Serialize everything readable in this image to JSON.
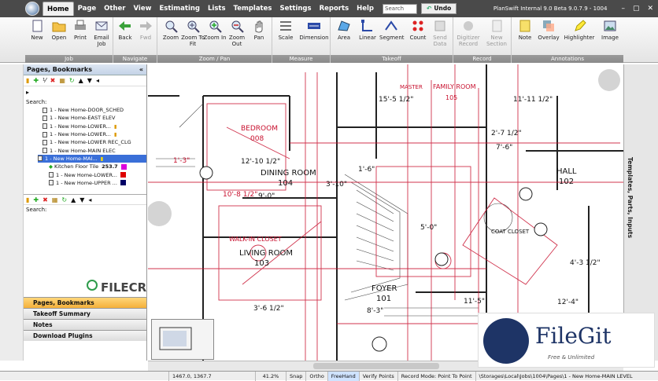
{
  "menubar": {
    "items": [
      "Home",
      "Page",
      "Other",
      "View",
      "Estimating",
      "Lists",
      "Templates",
      "Settings",
      "Reports",
      "Help"
    ],
    "search_value": "Search",
    "undo_label": "Undo",
    "window_title": "PlanSwift Internal 9.0 Beta  9.0.7.9 - 1004",
    "min": "–",
    "max": "▢",
    "close": "✕"
  },
  "ribbon": {
    "groups": [
      {
        "label": "Job",
        "buttons": [
          "New",
          "Open",
          "Print",
          "Email Job"
        ]
      },
      {
        "label": "Navigate",
        "buttons": [
          "Back",
          "Fwd"
        ]
      },
      {
        "label": "Zoom / Pan",
        "buttons": [
          "Zoom",
          "Zoom To Fit",
          "Zoom In",
          "Zoom Out",
          "Pan"
        ]
      },
      {
        "label": "Measure",
        "buttons": [
          "Scale",
          "Dimension"
        ]
      },
      {
        "label": "Takeoff",
        "buttons": [
          "Area",
          "Linear",
          "Segment",
          "Count",
          "Send Data"
        ]
      },
      {
        "label": "Record",
        "buttons": [
          "Digitizer Record",
          "New Section"
        ]
      },
      {
        "label": "Annotations",
        "buttons": [
          "Note",
          "Overlay",
          "Highlighter",
          "Image"
        ]
      }
    ]
  },
  "sidebar": {
    "header": "Pages, Bookmarks",
    "collapse": "«",
    "search_label": "Search:",
    "tree": [
      "1 - New Home-DOOR_SCHED",
      "1 - New Home-EAST ELEV",
      "1 - New Home-LOWER...",
      "1 - New Home-LOWER...",
      "1 - New Home-LOWER REC_CLG",
      "1 - New Home-MAIN ELEC",
      "1 - New Home-MAI...",
      "Kitchen Floor Tile",
      "1 - New Home-LOWER...",
      "1 - New Home-UPPER ..."
    ],
    "kitchen_value": "253.7",
    "search2_label": "Search:",
    "nav_tabs": [
      "Pages, Bookmarks",
      "Takeoff Summary",
      "Notes",
      "Download Plugins"
    ]
  },
  "right_panel": {
    "label": "Templates, Parts, Inputs"
  },
  "statusbar": {
    "coords": "1467.0, 1367.7",
    "zoom": "41.2%",
    "snap": "Snap",
    "ortho": "Ortho",
    "freehand": "FreeHand",
    "verify": "Verify Points",
    "record_mode": "Record Mode: Point To Point",
    "path": "\\Storages\\Local\\Jobs\\1004\\Pages\\1 - New Home-MAIN LEVEL"
  },
  "plan_labels": {
    "bedroom": "BEDROOM",
    "bedroom_code": "008",
    "dining": "DINING ROOM",
    "dining_code": "104",
    "living": "LIVING ROOM",
    "living_code": "103",
    "walkin": "WALK-IN CLOSET",
    "foyer": "FOYER",
    "foyer_code": "101",
    "hall": "HALL",
    "hall_code": "102",
    "family": "FAMILY ROOM",
    "family_code": "105",
    "master": "MASTER",
    "coat": "COAT CLOSET",
    "dims": [
      "15'-5 1/2\"",
      "11'-11 1/2\"",
      "12'-10 1/2\"",
      "10'-8 1/2\"",
      "9'-0\"",
      "1'-6\"",
      "3'-10\"",
      "7'-6\"",
      "5'-0\"",
      "2'-7 1/2\"",
      "11'-5\"",
      "8'-3\"",
      "3'-6 1/2\"",
      "1'-3\"",
      "4'-3 1/2\"",
      "12'-4\""
    ]
  },
  "watermarks": {
    "filecr": "FILECR",
    "filegit": "FileGit",
    "filegit_tag": "Free & Unlimited"
  },
  "colors": {
    "menubar": "#4a4a4a",
    "plan_red": "#c8102e",
    "selection": "#3a6fd8",
    "active_tab": "#f4b03a"
  }
}
